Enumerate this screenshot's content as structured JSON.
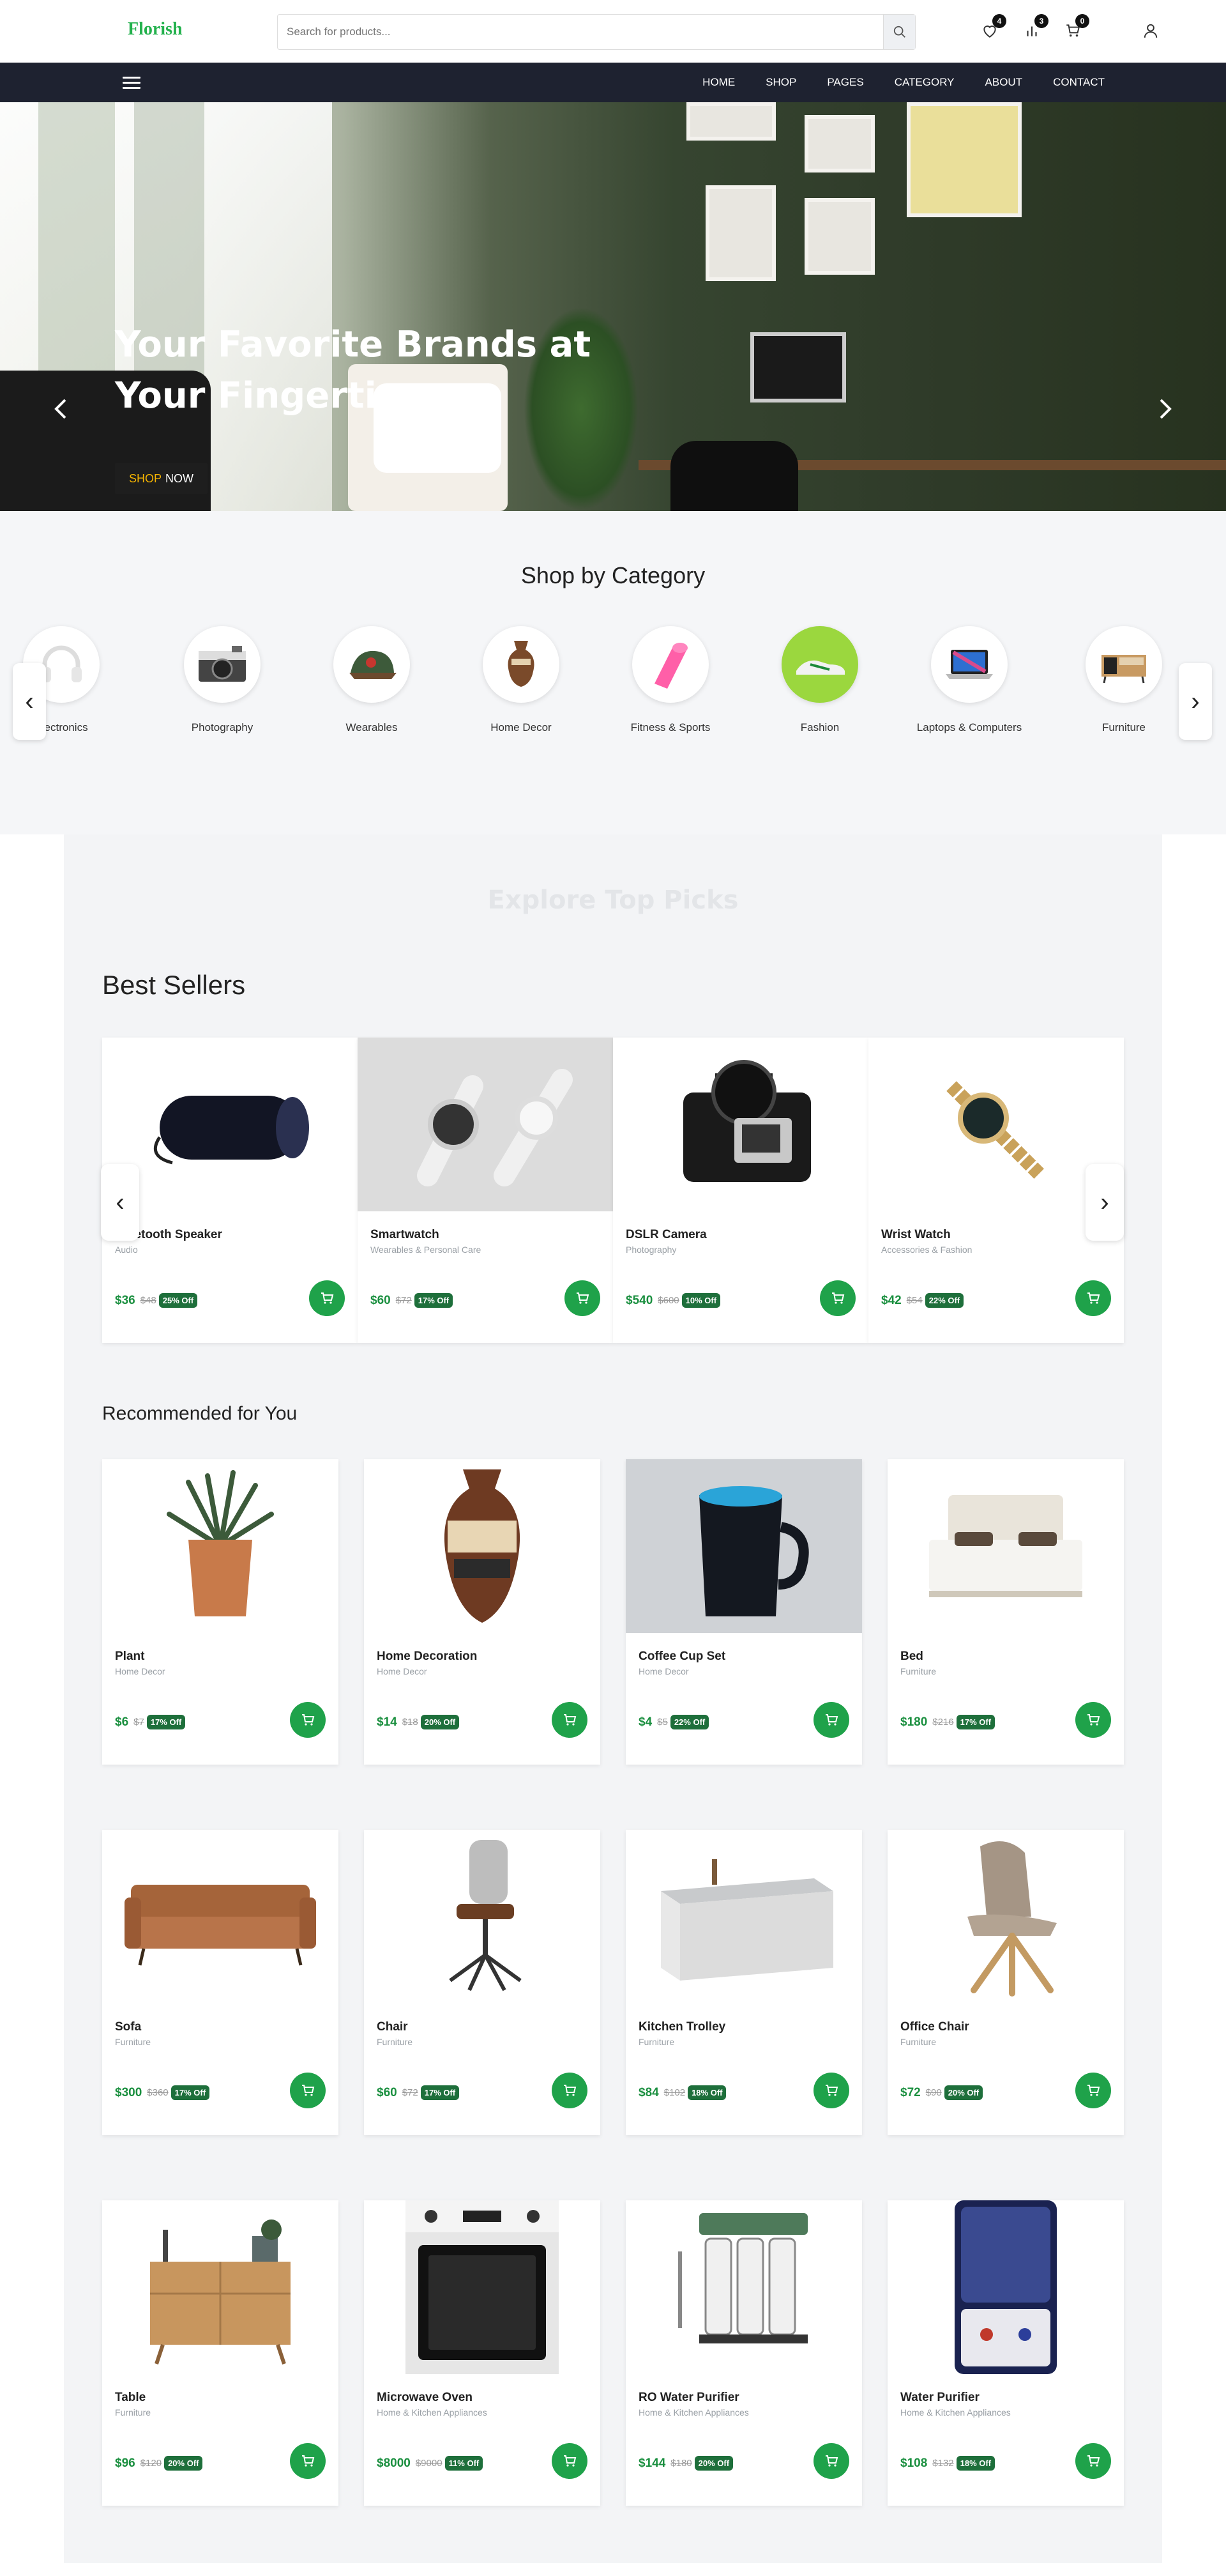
{
  "header": {
    "logo": "Florish",
    "search_placeholder": "Search for products...",
    "wishlist_count": "4",
    "compare_count": "3",
    "cart_count": "0"
  },
  "nav": {
    "links": [
      "HOME",
      "SHOP",
      "PAGES",
      "CATEGORY",
      "ABOUT",
      "CONTACT"
    ]
  },
  "hero": {
    "title_line1": "Your Favorite Brands at",
    "title_line2": "Your Fingertips",
    "cta_accent": "SHOP",
    "cta_rest": "NOW"
  },
  "categories": {
    "title": "Shop by Category",
    "items": [
      {
        "label": "Electronics"
      },
      {
        "label": "Photography"
      },
      {
        "label": "Wearables"
      },
      {
        "label": "Home Decor"
      },
      {
        "label": "Fitness & Sports"
      },
      {
        "label": "Fashion"
      },
      {
        "label": "Laptops & Computers"
      },
      {
        "label": "Furniture"
      }
    ]
  },
  "explore_title": "Explore Top Picks",
  "best_sellers": {
    "title": "Best Sellers",
    "products": [
      {
        "name": "Bluetooth Speaker",
        "category": "Audio",
        "price": "$36",
        "old_price": "$48",
        "discount": "25% Off"
      },
      {
        "name": "Smartwatch",
        "category": "Wearables & Personal Care",
        "price": "$60",
        "old_price": "$72",
        "discount": "17% Off"
      },
      {
        "name": "DSLR Camera",
        "category": "Photography",
        "price": "$540",
        "old_price": "$600",
        "discount": "10% Off"
      },
      {
        "name": "Wrist Watch",
        "category": "Accessories & Fashion",
        "price": "$42",
        "old_price": "$54",
        "discount": "22% Off"
      }
    ]
  },
  "recommended": {
    "title": "Recommended for You",
    "products": [
      {
        "name": "Plant",
        "category": "Home Decor",
        "price": "$6",
        "old_price": "$7",
        "discount": "17% Off"
      },
      {
        "name": "Home Decoration",
        "category": "Home Decor",
        "price": "$14",
        "old_price": "$18",
        "discount": "20% Off"
      },
      {
        "name": "Coffee Cup Set",
        "category": "Home Decor",
        "price": "$4",
        "old_price": "$5",
        "discount": "22% Off"
      },
      {
        "name": "Bed",
        "category": "Furniture",
        "price": "$180",
        "old_price": "$216",
        "discount": "17% Off"
      },
      {
        "name": "Sofa",
        "category": "Furniture",
        "price": "$300",
        "old_price": "$360",
        "discount": "17% Off"
      },
      {
        "name": "Chair",
        "category": "Furniture",
        "price": "$60",
        "old_price": "$72",
        "discount": "17% Off"
      },
      {
        "name": "Kitchen Trolley",
        "category": "Furniture",
        "price": "$84",
        "old_price": "$102",
        "discount": "18% Off"
      },
      {
        "name": "Office Chair",
        "category": "Furniture",
        "price": "$72",
        "old_price": "$90",
        "discount": "20% Off"
      },
      {
        "name": "Table",
        "category": "Furniture",
        "price": "$96",
        "old_price": "$120",
        "discount": "20% Off"
      },
      {
        "name": "Microwave Oven",
        "category": "Home & Kitchen Appliances",
        "price": "$8000",
        "old_price": "$9000",
        "discount": "11% Off"
      },
      {
        "name": "RO Water Purifier",
        "category": "Home & Kitchen Appliances",
        "price": "$144",
        "old_price": "$180",
        "discount": "20% Off"
      },
      {
        "name": "Water Purifier",
        "category": "Home & Kitchen Appliances",
        "price": "$108",
        "old_price": "$132",
        "discount": "18% Off"
      }
    ]
  }
}
